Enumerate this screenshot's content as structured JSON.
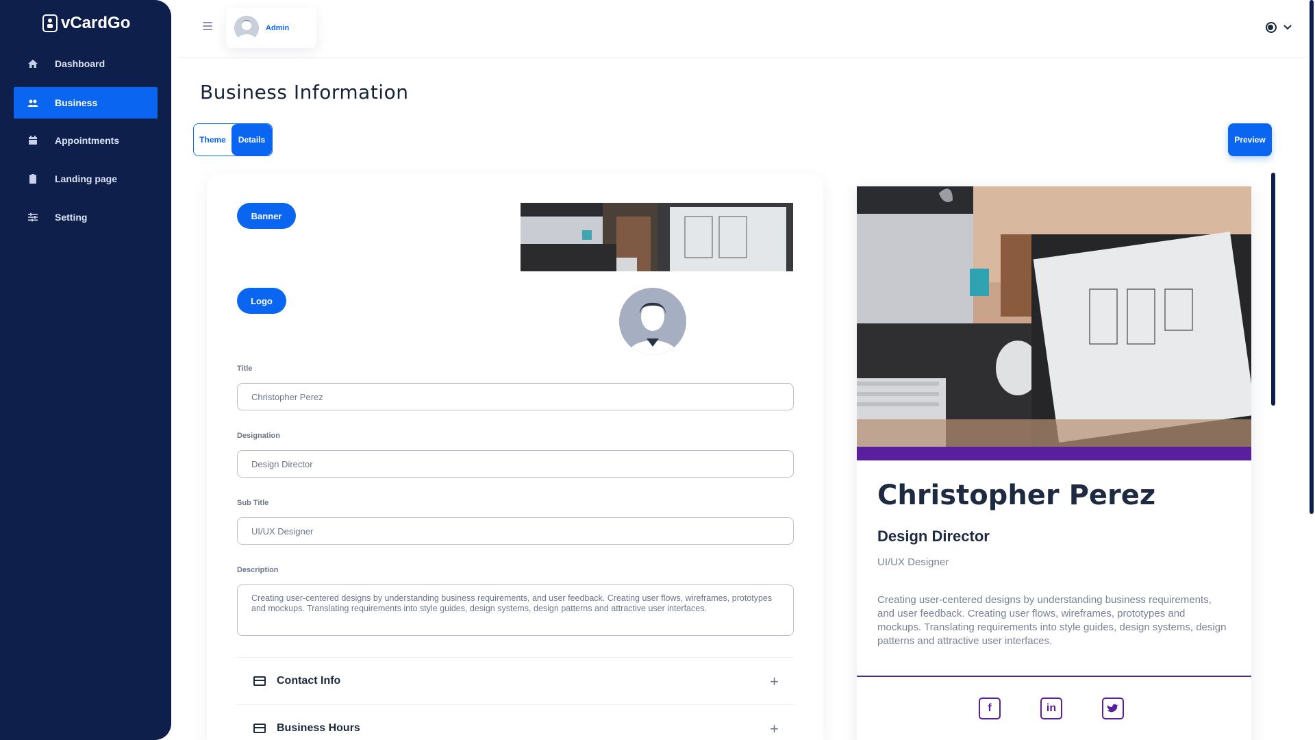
{
  "app": {
    "brand": "vCardGo"
  },
  "sidebar": {
    "items": [
      {
        "label": "Dashboard",
        "icon": "home-icon",
        "active": false
      },
      {
        "label": "Business",
        "icon": "users-icon",
        "active": true
      },
      {
        "label": "Appointments",
        "icon": "calendar-icon",
        "active": false
      },
      {
        "label": "Landing page",
        "icon": "clipboard-icon",
        "active": false
      },
      {
        "label": "Setting",
        "icon": "sliders-icon",
        "active": false
      }
    ]
  },
  "header": {
    "user_name": "Admin",
    "language_icon": "globe-icon"
  },
  "page": {
    "title": "Business Information",
    "tabs": {
      "theme": "Theme",
      "details": "Details"
    },
    "preview_label": "Preview"
  },
  "form": {
    "banner_label": "Banner",
    "logo_label": "Logo",
    "fields": {
      "title_label": "Title",
      "title_value": "Christopher  Perez",
      "designation_label": "Designation",
      "designation_value": "Design Director",
      "subtitle_label": "Sub Title",
      "subtitle_value": "UI/UX Designer",
      "description_label": "Description",
      "description_value": "Creating user-centered designs by understanding business requirements, and user feedback. Creating user flows, wireframes, prototypes and mockups. Translating requirements into style guides, design systems, design patterns and attractive user interfaces."
    },
    "accordions": [
      {
        "label": "Contact Info"
      },
      {
        "label": "Business Hours"
      }
    ]
  },
  "preview": {
    "name": "Christopher Perez",
    "designation": "Design Director",
    "subtitle": "UI/UX Designer",
    "description": "Creating user-centered designs by understanding business requirements, and user feedback. Creating user flows, wireframes, prototypes and mockups. Translating requirements into style guides, design systems, design patterns and attractive user interfaces.",
    "socials": [
      {
        "icon": "facebook-icon",
        "glyph": "f"
      },
      {
        "icon": "linkedin-icon",
        "glyph": "in"
      },
      {
        "icon": "twitter-icon",
        "glyph": "t"
      }
    ]
  },
  "colors": {
    "primary": "#0a66f0",
    "sidebar": "#0e1f4b",
    "accent": "#5a1f9e"
  }
}
